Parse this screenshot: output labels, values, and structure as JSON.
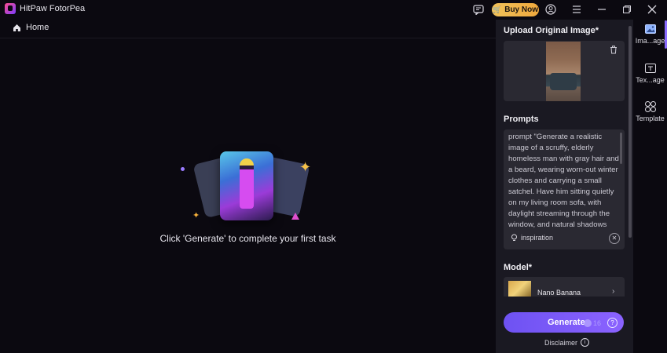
{
  "app": {
    "title": "HitPaw FotorPea"
  },
  "titlebar": {
    "buy_now": "Buy Now"
  },
  "nav": {
    "home": "Home"
  },
  "canvas": {
    "empty_message": "Click 'Generate' to complete your first task"
  },
  "panel": {
    "upload_title": "Upload Original Image*",
    "prompts_title": "Prompts",
    "prompt_text": "prompt \"Generate a realistic image of a scruffy, elderly homeless man with gray hair and a beard, wearing worn-out winter clothes and carrying a small satchel. Have him sitting quietly on my living room sofa, with daylight streaming through the window, and natural shadows matching the room's lighting. The overall mood should be photorealistic and neutral—no",
    "inspiration_label": "inspiration",
    "model_title": "Model*",
    "model_name": "Nano Banana",
    "generate_label": "Generate",
    "credit_count": "16",
    "disclaimer": "Disclaimer"
  },
  "rail": {
    "items": [
      {
        "label": "Ima...age",
        "icon": "image-icon"
      },
      {
        "label": "Tex...age",
        "icon": "text-image-icon"
      },
      {
        "label": "Template",
        "icon": "template-grid-icon"
      }
    ]
  },
  "colors": {
    "accent": "#7c5cff",
    "buy_now": "#f0b64a",
    "panel_bg": "#1a1922",
    "app_bg": "#0b0910"
  }
}
